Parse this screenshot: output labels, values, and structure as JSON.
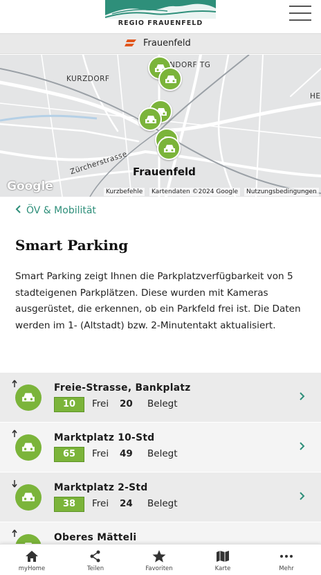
{
  "header": {
    "logo_text": "REGIO FRAUENFELD",
    "menu_icon": "hamburger-icon"
  },
  "location": {
    "icon": "location-pin-icon",
    "name": "Frauenfeld"
  },
  "map": {
    "labels": {
      "kurzdorf": "KURZDORF",
      "ndorf": "NDORF TG",
      "he": "HE",
      "zuercher": "Zürcherstrasse",
      "city": "Frauenfeld"
    },
    "google": "Google",
    "attribution": {
      "shortcuts": "Kurzbefehle",
      "mapdata": "Kartendaten ©2024 Google",
      "terms": "Nutzungsbedingungen"
    },
    "pin_icon": "car-icon"
  },
  "breadcrumb": {
    "back_label": "ÖV & Mobilität",
    "back_icon": "chevron-left-icon"
  },
  "page": {
    "title": "Smart Parking",
    "intro": "Smart Parking zeigt Ihnen die Parkplatzverfügbarkeit von 5 stadteigenen Parkplätzen. Diese wurden mit Kameras ausgerüstet, die erkennen, ob ein Parkfeld frei ist. Die Daten werden im 1- (Altstadt) bzw. 2-Minutentakt aktualisiert."
  },
  "parking": {
    "free_label": "Frei",
    "occupied_label": "Belegt",
    "items": [
      {
        "name": "Freie-Strasse, Bankplatz",
        "free": "10",
        "occupied": "20",
        "trend": "up"
      },
      {
        "name": "Marktplatz 10-Std",
        "free": "65",
        "occupied": "49",
        "trend": "up"
      },
      {
        "name": "Marktplatz 2-Std",
        "free": "38",
        "occupied": "24",
        "trend": "down"
      },
      {
        "name": "Oberes Mätteli",
        "free": "",
        "occupied": "",
        "trend": "up"
      }
    ]
  },
  "bottom_nav": [
    {
      "label": "myHome",
      "icon": "home-icon"
    },
    {
      "label": "Teilen",
      "icon": "share-icon"
    },
    {
      "label": "Favoriten",
      "icon": "star-icon"
    },
    {
      "label": "Karte",
      "icon": "map-icon"
    },
    {
      "label": "Mehr",
      "icon": "more-icon"
    }
  ],
  "colors": {
    "brand": "#2e8f7a",
    "marker_green": "#7bb43a"
  }
}
